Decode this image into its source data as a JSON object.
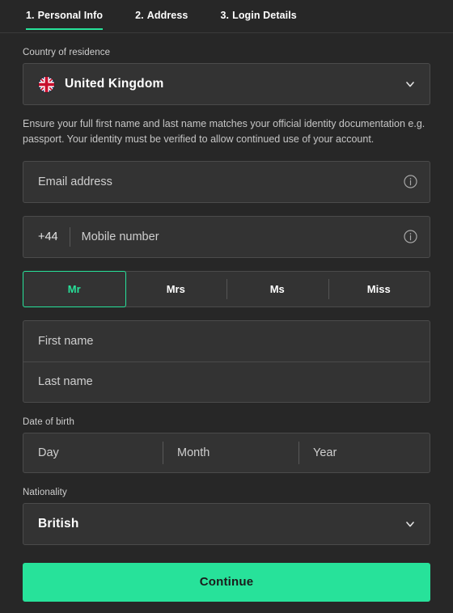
{
  "theme": {
    "background": "#272727",
    "field_background": "#333333",
    "field_border": "#4b4b4b",
    "accent": "#27e29a",
    "text_primary": "#ffffff",
    "text_muted": "#cfcfcf"
  },
  "stepper": {
    "tabs": [
      {
        "number": "1.",
        "label": "Personal Info",
        "active": true
      },
      {
        "number": "2.",
        "label": "Address",
        "active": false
      },
      {
        "number": "3.",
        "label": "Login Details",
        "active": false
      }
    ]
  },
  "form": {
    "country": {
      "label": "Country of residence",
      "value": "United Kingdom",
      "flag_icon": "uk-flag-icon",
      "chevron_icon": "chevron-down-icon"
    },
    "helper_text": "Ensure your full first name and last name matches your official identity documentation e.g. passport. Your identity must be verified to allow continued use of your account.",
    "email": {
      "placeholder": "Email address",
      "value": "",
      "info_icon": "info-icon"
    },
    "mobile": {
      "dial_code": "+44",
      "placeholder": "Mobile number",
      "value": "",
      "info_icon": "info-icon"
    },
    "title": {
      "options": [
        "Mr",
        "Mrs",
        "Ms",
        "Miss"
      ],
      "selected": "Mr"
    },
    "first_name": {
      "placeholder": "First name",
      "value": ""
    },
    "last_name": {
      "placeholder": "Last name",
      "value": ""
    },
    "date_of_birth": {
      "label": "Date of birth",
      "day": {
        "placeholder": "Day",
        "value": ""
      },
      "month": {
        "placeholder": "Month",
        "value": ""
      },
      "year": {
        "placeholder": "Year",
        "value": ""
      }
    },
    "nationality": {
      "label": "Nationality",
      "value": "British",
      "chevron_icon": "chevron-down-icon"
    },
    "submit_label": "Continue"
  }
}
